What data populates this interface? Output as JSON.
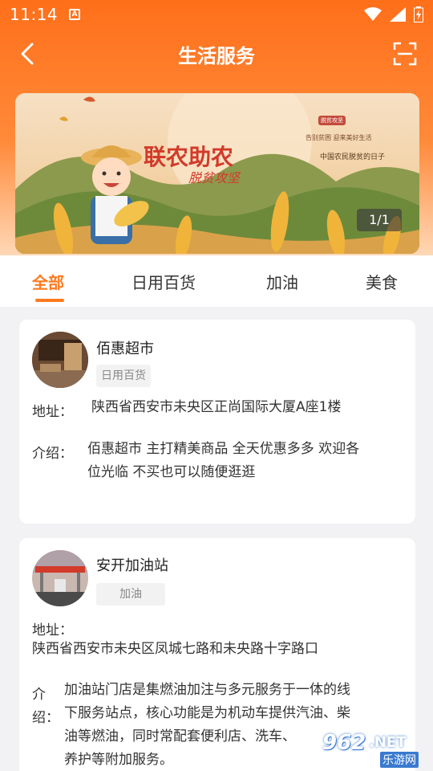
{
  "status": {
    "time": "11:14",
    "app_icon": "A"
  },
  "nav": {
    "title": "生活服务"
  },
  "banner": {
    "headline": "联农助农",
    "subline": "脱贫攻坚",
    "tagline": "中国农民脱贫的日子",
    "small_text": "告别贫困 迎来美好生活",
    "badge": "脱贫攻坚",
    "counter": "1/1"
  },
  "tabs": [
    {
      "label": "全部"
    },
    {
      "label": "日用百货"
    },
    {
      "label": "加油"
    },
    {
      "label": "美食"
    }
  ],
  "stores": [
    {
      "name": "佰惠超市",
      "tag": "日用百货",
      "address_label": "地址：",
      "address": "陕西省西安市未央区正尚国际大厦A座1楼",
      "intro_label": "介绍：",
      "intro_line1": "佰惠超市 主打精美商品 全天优惠多多 欢迎各",
      "intro_line2": "位光临 不买也可以随便逛逛"
    },
    {
      "name": "安开加油站",
      "tag": "加油",
      "address_label": "地址：",
      "address": "陕西省西安市未央区凤城七路和未央路十字路口",
      "intro_label_1": "介",
      "intro_label_2": "绍：",
      "intro_line1": "加油站门店是集燃油加注与多元服务于一体的线",
      "intro_line2": "下服务站点，核心功能是为机动车提供汽油、柴",
      "intro_line3": "油等燃油，同时常配套便利店、洗车、",
      "intro_line4": "养护等附加服务。"
    }
  ],
  "watermark": {
    "number": "962",
    "suffix": ".NET",
    "subtitle": "乐游网"
  },
  "colors": {
    "accent": "#ff7a1f",
    "header_top": "#ff6f1a"
  },
  "icons": [
    "wifi-icon",
    "signal-icon",
    "battery-icon",
    "back-arrow-icon",
    "scan-icon"
  ]
}
